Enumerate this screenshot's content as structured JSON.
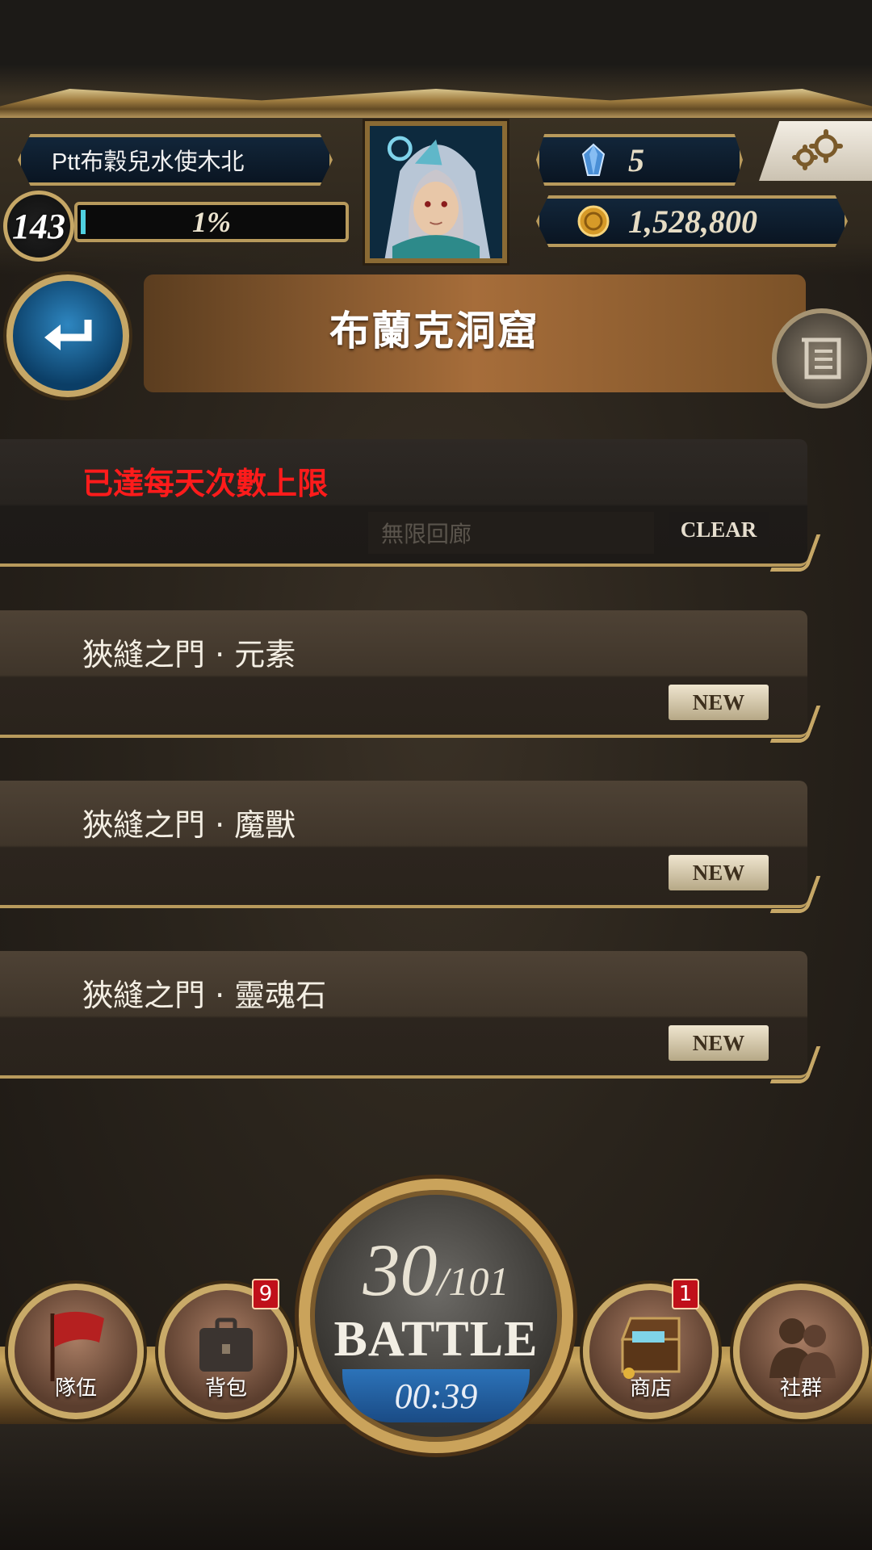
{
  "player": {
    "name": "Ptt布穀兒水使木北",
    "level": "143",
    "exp_percent_text": "1%",
    "exp_fraction": 0.01,
    "gems": "5",
    "coins": "1,528,800"
  },
  "header": {
    "title": "布蘭克洞窟"
  },
  "stages": [
    {
      "title": "已達每天次數上限",
      "sub": "無限回廊",
      "tag": "CLEAR",
      "limit_reached": true
    },
    {
      "title": "狹縫之門 · 元素",
      "tag": "NEW"
    },
    {
      "title": "狹縫之門 · 魔獸",
      "tag": "NEW"
    },
    {
      "title": "狹縫之門 · 靈魂石",
      "tag": "NEW"
    }
  ],
  "battle": {
    "current": "30",
    "max": "/101",
    "label": "BATTLE",
    "timer": "00:39"
  },
  "nav": {
    "team": {
      "label": "隊伍",
      "icon": "flag-icon"
    },
    "bag": {
      "label": "背包",
      "icon": "bag-icon",
      "badge": "9"
    },
    "shop": {
      "label": "商店",
      "icon": "treasure-chest-icon",
      "badge": "1"
    },
    "social": {
      "label": "社群",
      "icon": "people-icon"
    }
  },
  "colors": {
    "limit_text": "#ff1b1b",
    "gold_frame": "#c6a766",
    "timer_blue": "#2c73b9",
    "badge_red": "#c0101a"
  }
}
